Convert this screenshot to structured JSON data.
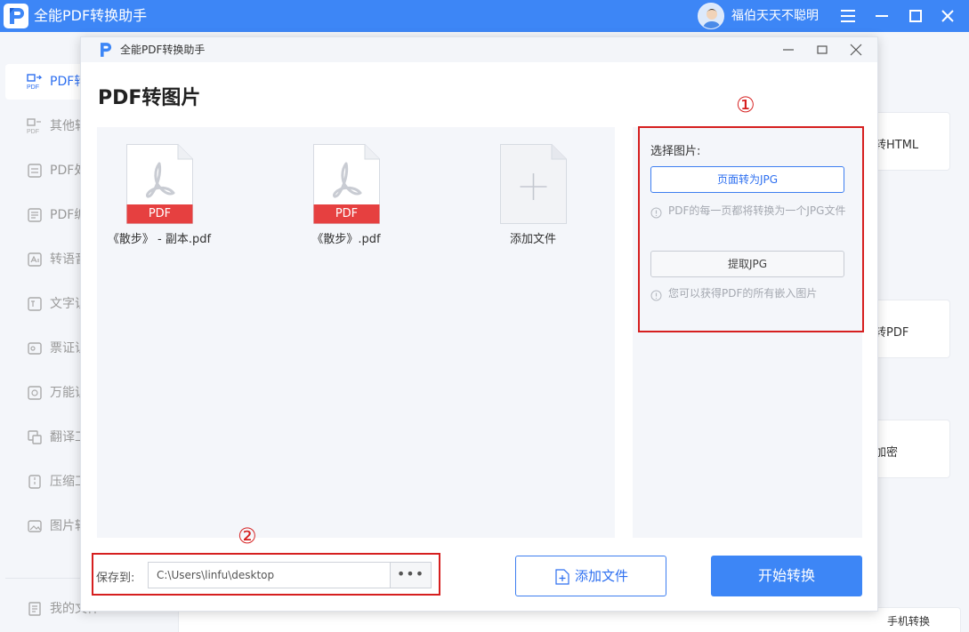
{
  "app": {
    "title": "全能PDF转换助手",
    "username": "福伯天天不聪明",
    "accent_color": "#3d86f6",
    "icons": [
      "logo-icon",
      "menu-icon",
      "minimize-icon",
      "maximize-icon",
      "close-icon"
    ]
  },
  "sidebar": {
    "items": [
      {
        "label": "PDF转",
        "icon": "pdf-convert-icon"
      },
      {
        "label": "其他转",
        "icon": "other-convert-icon"
      },
      {
        "label": "PDF处",
        "icon": "pdf-process-icon"
      },
      {
        "label": "PDF编",
        "icon": "pdf-edit-icon"
      },
      {
        "label": "转语音",
        "icon": "to-speech-icon"
      },
      {
        "label": "文字识",
        "icon": "text-recognition-icon"
      },
      {
        "label": "票证识",
        "icon": "ticket-recognition-icon"
      },
      {
        "label": "万能识",
        "icon": "universal-recognition-icon"
      },
      {
        "label": "翻译工",
        "icon": "translate-icon"
      },
      {
        "label": "压缩工",
        "icon": "compress-icon"
      },
      {
        "label": "图片转",
        "icon": "image-convert-icon"
      },
      {
        "label": "我的文件",
        "icon": "my-files-icon"
      }
    ]
  },
  "background": {
    "cards": [
      "转HTML",
      "转PDF",
      "加密"
    ],
    "bottom_label": "手机转换"
  },
  "dialog": {
    "title": "全能PDF转换助手",
    "heading": "PDF转图片",
    "files": [
      {
        "name": "《散步》 - 副本.pdf",
        "badge": "PDF"
      },
      {
        "name": "《散步》.pdf",
        "badge": "PDF"
      }
    ],
    "add_file_tile": "添加文件",
    "options": {
      "title": "选择图片:",
      "btn_page_to_jpg": "页面转为JPG",
      "hint_page": "PDF的每一页都将转换为一个JPG文件",
      "btn_extract_jpg": "提取JPG",
      "hint_extract": "您可以获得PDF的所有嵌入图片"
    },
    "annotations": {
      "one": "①",
      "two": "②"
    },
    "save": {
      "label": "保存到:",
      "path": "C:\\Users\\linfu\\desktop",
      "more": "•••"
    },
    "add_file_button": "添加文件",
    "start_button": "开始转换"
  }
}
